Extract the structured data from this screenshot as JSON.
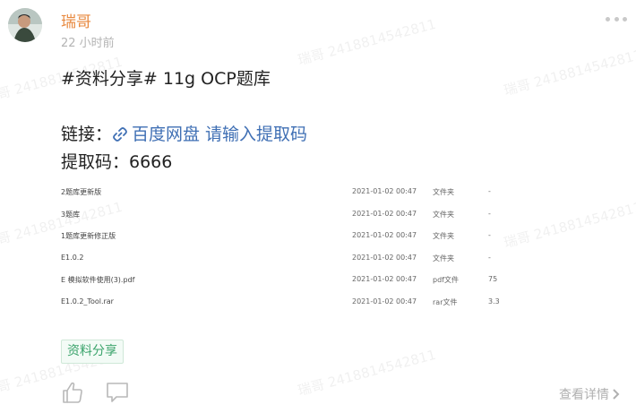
{
  "post": {
    "author": "瑞哥",
    "time": "22 小时前",
    "content": {
      "line1": "#资料分享# 11g OCP题库",
      "link_label": "链接：",
      "link_text": "百度网盘 请输入提取码",
      "code_line": "提取码：6666"
    },
    "files": [
      {
        "name": "2题库更新版",
        "date": "2021-01-02 00:47",
        "type": "文件夹",
        "size": "-"
      },
      {
        "name": "3题库",
        "date": "2021-01-02 00:47",
        "type": "文件夹",
        "size": "-"
      },
      {
        "name": "1题库更新修正版",
        "date": "2021-01-02 00:47",
        "type": "文件夹",
        "size": "-"
      },
      {
        "name": "E1.0.2",
        "date": "2021-01-02 00:47",
        "type": "文件夹",
        "size": "-"
      },
      {
        "name": "E 模拟软件使用(3).pdf",
        "date": "2021-01-02 00:47",
        "type": "pdf文件",
        "size": "75"
      },
      {
        "name": "E1.0.2_Tool.rar",
        "date": "2021-01-02 00:47",
        "type": "rar文件",
        "size": "3.3"
      }
    ],
    "tag": "资料分享",
    "detail_label": "查看详情",
    "watermark": "瑞哥 2418814542811"
  },
  "icons": {
    "more": "more-dots-icon",
    "link": "link-icon",
    "like": "thumb-up-icon",
    "comment": "comment-icon",
    "detail": "chevron-right-icon"
  },
  "colors": {
    "author": "#e8893f",
    "link": "#3f6fb4",
    "tag_text": "#3aa36b",
    "tag_bg": "#f3fbf6"
  }
}
